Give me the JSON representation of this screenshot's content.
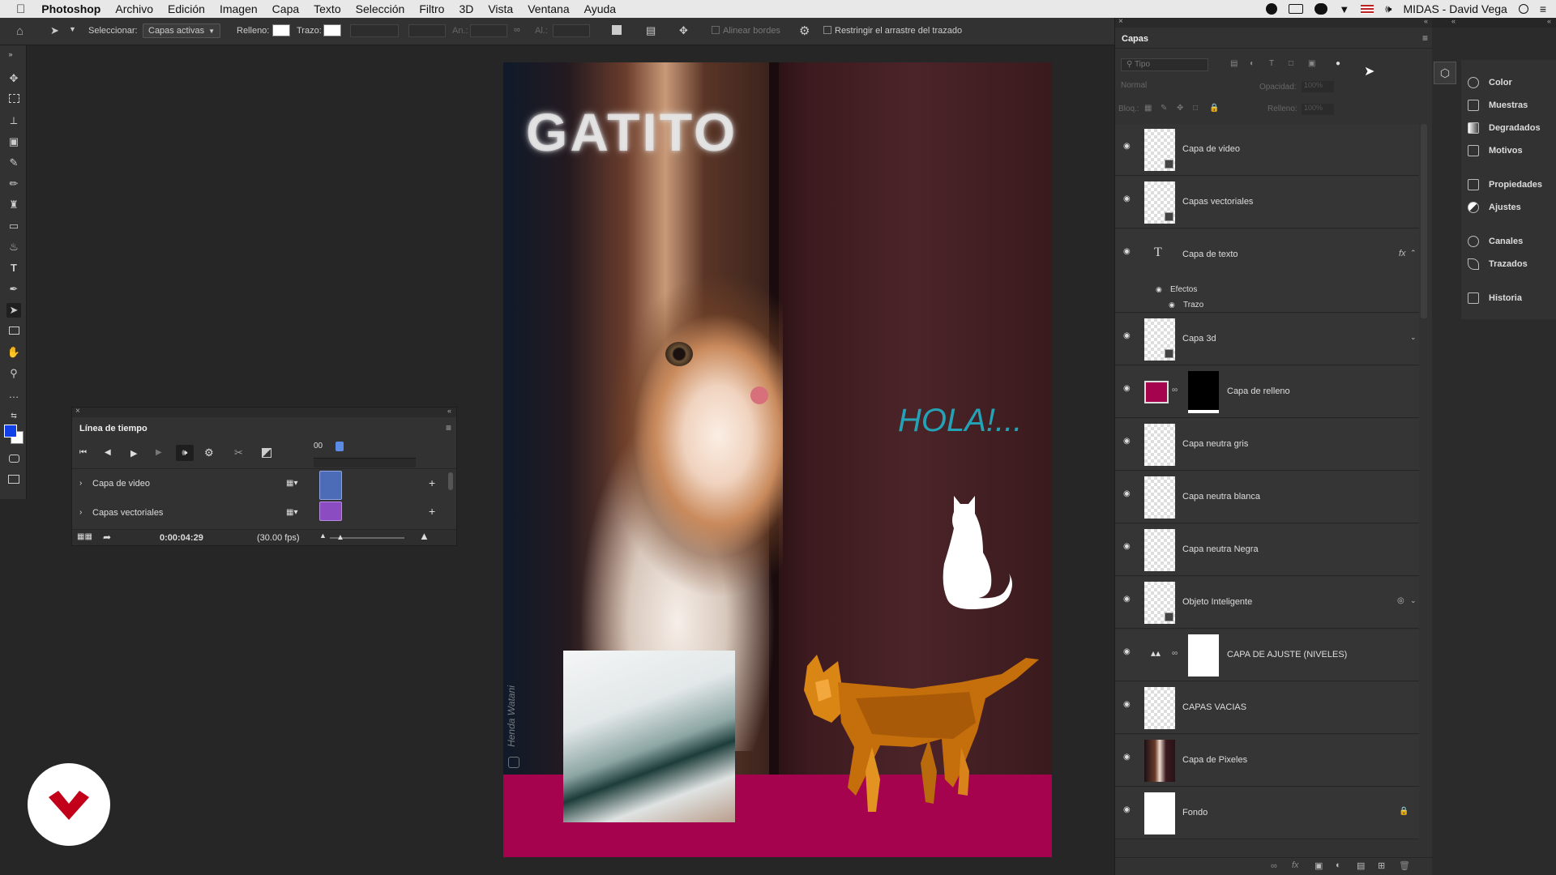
{
  "menubar": {
    "apple": "",
    "app": "Photoshop",
    "items": [
      "Archivo",
      "Edición",
      "Imagen",
      "Capa",
      "Texto",
      "Selección",
      "Filtro",
      "3D",
      "Vista",
      "Ventana",
      "Ayuda"
    ],
    "user": "MIDAS - David Vega"
  },
  "optbar": {
    "select_label": "Seleccionar:",
    "select_value": "Capas activas",
    "fill_label": "Relleno:",
    "stroke_label": "Trazo:",
    "w_label": "An.:",
    "h_label": "Al.:",
    "align_edges": "Alinear bordes",
    "restrict": "Restringir el arrastre del trazado"
  },
  "canvas": {
    "title_text": "GATITO",
    "hola_text": "HOLA!...",
    "watermark": "Henda Watani",
    "colors": {
      "floor": "#a6034f",
      "hola": "#25a3b6",
      "bg": "#3a1b1f"
    }
  },
  "timeline": {
    "title": "Línea de tiempo",
    "frame_label": "00",
    "rows": [
      "Capa de video",
      "Capas vectoriales"
    ],
    "time": "0:00:04:29",
    "fps": "(30.00 fps)"
  },
  "layers_panel": {
    "tab": "Capas",
    "filter_placeholder": "Tipo",
    "blend_mode": "Normal",
    "opacity_label": "Opacidad:",
    "opacity_value": "100%",
    "lock_label": "Bloq.:",
    "fill_label": "Relleno:",
    "fill_value": "100%",
    "items": [
      {
        "name": "Capa de video"
      },
      {
        "name": "Capas vectoriales"
      },
      {
        "name": "Capa de texto"
      },
      {
        "name": "Capa 3d"
      },
      {
        "name": "Capa de relleno"
      },
      {
        "name": "Capa neutra gris"
      },
      {
        "name": "Capa neutra blanca"
      },
      {
        "name": "Capa neutra Negra"
      },
      {
        "name": "Objeto Inteligente"
      },
      {
        "name": "CAPA DE AJUSTE (NIVELES)"
      },
      {
        "name": "CAPAS VACIAS"
      },
      {
        "name": "Capa de Pixeles"
      },
      {
        "name": "Fondo"
      }
    ],
    "effects_label": "Efectos",
    "stroke_effect": "Trazo",
    "fx_label": "fx"
  },
  "dock": {
    "items": [
      "Color",
      "Muestras",
      "Degradados",
      "Motivos",
      "Propiedades",
      "Ajustes",
      "Canales",
      "Trazados",
      "Historia"
    ]
  }
}
